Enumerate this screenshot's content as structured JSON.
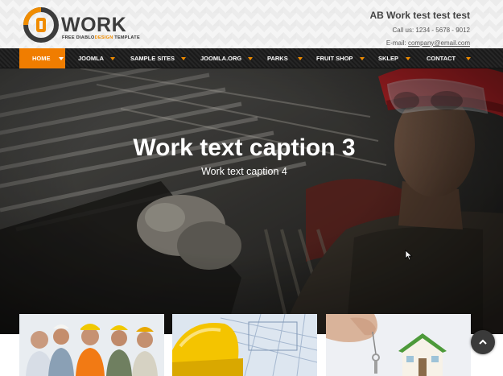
{
  "logo": {
    "word": "WORK",
    "tagline_prefix": "FREE DIABLO",
    "tagline_highlight": "DESIGN",
    "tagline_suffix": " TEMPLATE"
  },
  "contact": {
    "company": "AB Work test test test",
    "phone_line": "Call us: 1234 - 5678 - 9012",
    "email_prefix": "E-mail: ",
    "email": "company@email.com"
  },
  "nav": {
    "items": [
      {
        "label": "HOME",
        "active": true
      },
      {
        "label": "JOOMLA"
      },
      {
        "label": "SAMPLE SITES"
      },
      {
        "label": "JOOMLA.ORG"
      },
      {
        "label": "PARKS"
      },
      {
        "label": "FRUIT SHOP"
      },
      {
        "label": "SKLEP"
      },
      {
        "label": "CONTACT"
      }
    ]
  },
  "hero": {
    "caption_title": "Work text caption 3",
    "caption_sub": "Work text caption 4"
  },
  "thumbnails": [
    {
      "icon": "workers-team-photo"
    },
    {
      "icon": "helmet-blueprints-photo"
    },
    {
      "icon": "house-keys-photo"
    }
  ],
  "colors": {
    "accent": "#f07d00",
    "nav_bg": "#1e1e1e",
    "logo_grey": "#3c3c3c"
  },
  "icons": {
    "scroll_top": "chevron-up-icon"
  }
}
